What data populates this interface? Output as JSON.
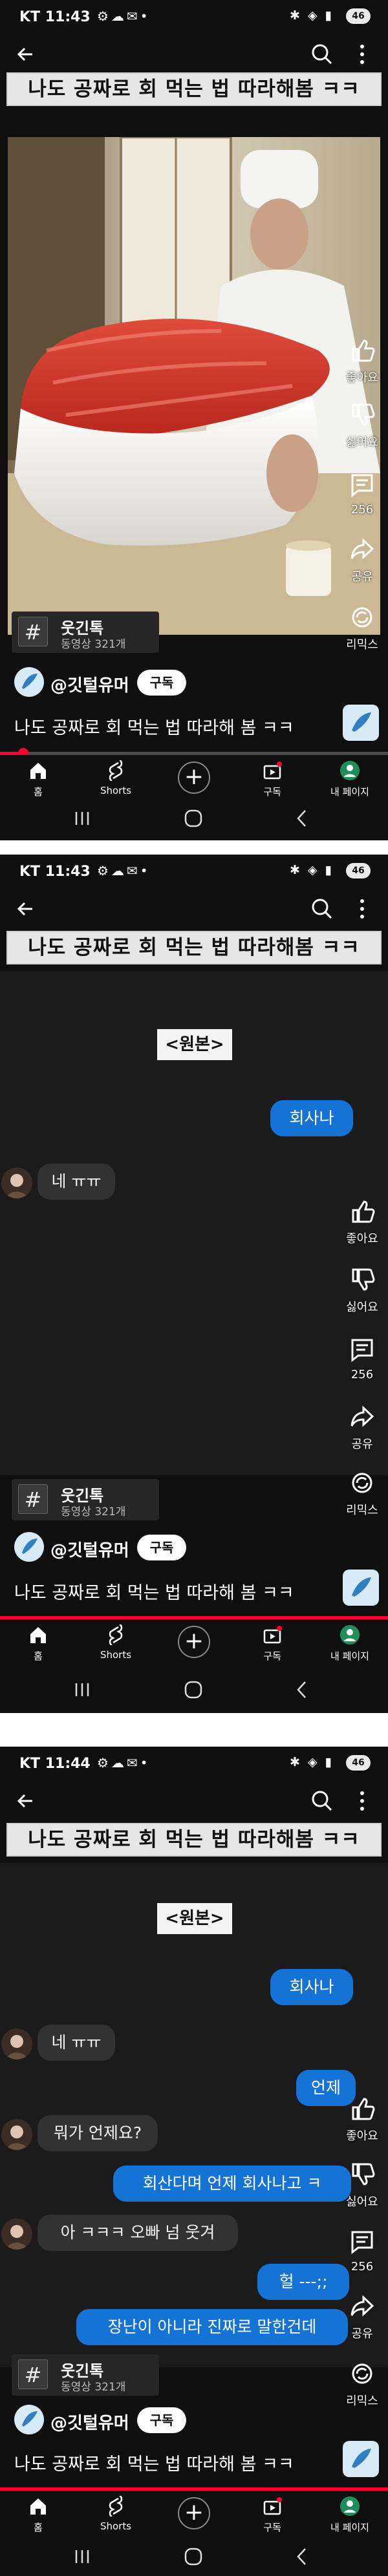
{
  "status": {
    "carrier_time_1": "KT 11:43",
    "carrier_time_2": "KT 11:43",
    "carrier_time_3": "KT 11:44",
    "battery": "46"
  },
  "video": {
    "title_overlay": "나도 공짜로 회 먹는 법 따라해봄 ㅋㅋ",
    "origin_label": "<원본>",
    "caption": "나도 공짜로 회 먹는 법 따라해 봄 ㅋㅋ",
    "author": "@깃털유머",
    "subscribe_label": "구독",
    "tag_name": "웃긴톡",
    "tag_sub": "동영상 321개",
    "progress": 0.06
  },
  "actions": {
    "like": "좋아요",
    "dislike": "싫어요",
    "comments": "256",
    "share": "공유",
    "remix": "리믹스"
  },
  "nav": {
    "home": "홈",
    "shorts": "Shorts",
    "subscriptions": "구독",
    "my_page": "내 페이지"
  },
  "chat": {
    "msg1": "회사나",
    "msg2": "네 ㅠㅠ",
    "msg3": "언제",
    "msg4": "뭐가 언제요?",
    "msg5": "회산다며 언제 회사나고 ㅋ",
    "msg6": "아 ㅋㅋㅋ 오빠 넘 웃겨",
    "msg7": "헐 ---;;",
    "msg8": "장난이 아니라 진짜로 말한건데"
  },
  "colors": {
    "accent_red": "#ff0033",
    "bubble_blue": "#1673d6",
    "bubble_gray": "#323232"
  }
}
